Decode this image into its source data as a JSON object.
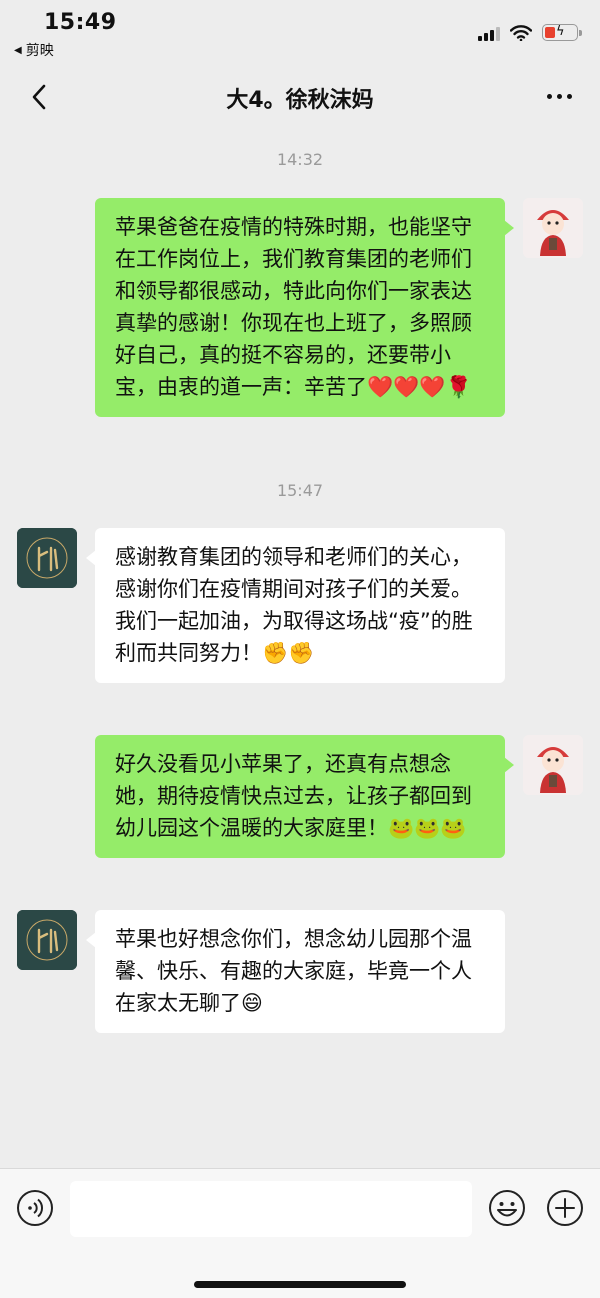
{
  "status": {
    "time": "15:49",
    "back_app": "剪映"
  },
  "nav": {
    "title": "大4。徐秋沫妈"
  },
  "messages": [
    {
      "timestamp": "14:32"
    },
    {
      "sender": "me",
      "text": "苹果爸爸在疫情的特殊时期，也能坚守在工作岗位上，我们教育集团的老师们和领导都很感动，特此向你们一家表达真挚的感谢！你现在也上班了，多照顾好自己，真的挺不容易的，还要带小宝，由衷的道一声：辛苦了❤️❤️❤️🌹"
    },
    {
      "timestamp": "15:47"
    },
    {
      "sender": "other",
      "text": "感谢教育集团的领导和老师们的关心，感谢你们在疫情期间对孩子们的关爱。我们一起加油，为取得这场战“疫”的胜利而共同努力！✊✊"
    },
    {
      "sender": "me",
      "text": "好久没看见小苹果了，还真有点想念她，期待疫情快点过去，让孩子都回到幼儿园这个温暖的大家庭里！🐸🐸🐸"
    },
    {
      "sender": "other",
      "text": "苹果也好想念你们，想念幼儿园那个温馨、快乐、有趣的大家庭，毕竟一个人在家太无聊了😄"
    }
  ],
  "icons": {
    "voice": "voice-icon",
    "emoji": "emoji-icon",
    "plus": "plus-icon",
    "back": "chevron-left-icon",
    "more": "more-icon",
    "wifi": "wifi-icon",
    "signal": "signal-icon",
    "battery": "battery-icon"
  },
  "colors": {
    "bubble_sent": "#95ec69",
    "bubble_received": "#ffffff",
    "background": "#ededed",
    "battery_low": "#e8412e"
  }
}
